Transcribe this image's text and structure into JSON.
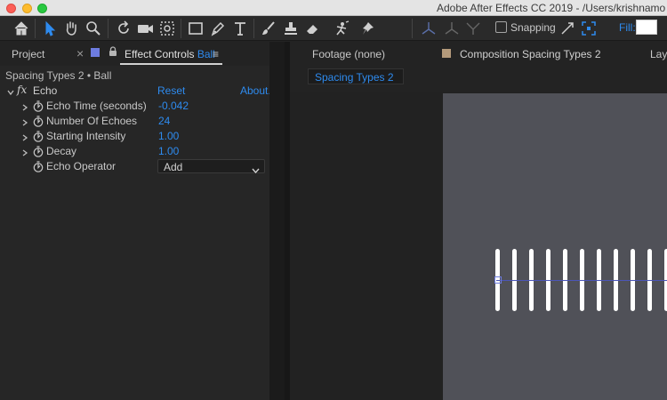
{
  "window": {
    "title": "Adobe After Effects CC 2019 - /Users/krishnamo"
  },
  "toolbar": {
    "snapping_label": "Snapping",
    "fill_label": "Fill:",
    "fill_color": "#ffffff",
    "accent_color": "#2e8bef",
    "tools": [
      "home-icon",
      "selection-arrow-icon",
      "hand-icon",
      "zoom-icon",
      "rotate-icon",
      "camera-icon",
      "pan-behind-icon",
      "rectangle-icon",
      "pen-icon",
      "type-icon",
      "brush-icon",
      "clone-stamp-icon",
      "eraser-icon",
      "roto-brush-icon",
      "puppet-pin-icon"
    ]
  },
  "left_panel": {
    "project_tab": "Project",
    "close_glyph": "×",
    "effect_controls_prefix": "Effect Controls",
    "effect_controls_target": "Ball",
    "menu_glyph": "≡",
    "layer_header": "Spacing Types 2 • Ball",
    "effect": {
      "fx": "fx",
      "name": "Echo",
      "reset": "Reset",
      "about": "About.",
      "params": [
        {
          "label": "Echo Time (seconds)",
          "value": "-0.042"
        },
        {
          "label": "Number Of Echoes",
          "value": "24"
        },
        {
          "label": "Starting Intensity",
          "value": "1.00"
        },
        {
          "label": "Decay",
          "value": "1.00"
        }
      ],
      "operator_label": "Echo Operator",
      "operator_value": "Add"
    }
  },
  "right_panel": {
    "footage_tab": "Footage (none)",
    "comp_tab": "Composition Spacing Types 2",
    "layer_tab": "Laye",
    "comp_subtab": "Spacing Types 2",
    "comp_swatch_color": "#b49a7b"
  }
}
